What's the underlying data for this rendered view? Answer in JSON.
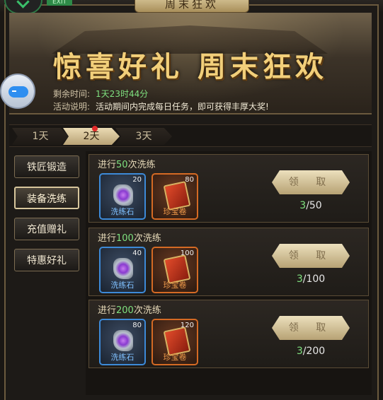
{
  "header": {
    "title": "周末狂欢",
    "exit_badge": "EXIT"
  },
  "banner": {
    "title": "惊喜好礼 周末狂欢",
    "remaining_label": "剩余时间:",
    "remaining_value": "1天23时44分",
    "desc_label": "活动说明:",
    "desc_value": "活动期间内完成每日任务，即可获得丰厚大奖!"
  },
  "day_tabs": [
    {
      "label": "1天"
    },
    {
      "label": "2天"
    },
    {
      "label": "3天"
    }
  ],
  "active_day_index": 1,
  "sidebar": {
    "items": [
      {
        "label": "铁匠锻造"
      },
      {
        "label": "装备洗练"
      },
      {
        "label": "充值赠礼"
      },
      {
        "label": "特惠好礼"
      }
    ],
    "active_index": 1
  },
  "tasks": [
    {
      "title_prefix": "进行",
      "title_count": "50",
      "title_suffix": "次洗练",
      "rewards": [
        {
          "name": "洗练石",
          "qty": "20",
          "icon": "refining-stone-icon"
        },
        {
          "name": "珍宝卷",
          "qty": "80",
          "icon": "treasure-scroll-icon"
        }
      ],
      "button_label": "领 取",
      "progress_current": "3",
      "progress_total": "/50"
    },
    {
      "title_prefix": "进行",
      "title_count": "100",
      "title_suffix": "次洗练",
      "rewards": [
        {
          "name": "洗练石",
          "qty": "40",
          "icon": "refining-stone-icon"
        },
        {
          "name": "珍宝卷",
          "qty": "100",
          "icon": "treasure-scroll-icon"
        }
      ],
      "button_label": "领 取",
      "progress_current": "3",
      "progress_total": "/100"
    },
    {
      "title_prefix": "进行",
      "title_count": "200",
      "title_suffix": "次洗练",
      "rewards": [
        {
          "name": "洗练石",
          "qty": "80",
          "icon": "refining-stone-icon"
        },
        {
          "name": "珍宝卷",
          "qty": "120",
          "icon": "treasure-scroll-icon"
        }
      ],
      "button_label": "领 取",
      "progress_current": "3",
      "progress_total": "/200"
    }
  ],
  "colors": {
    "accent_gold": "#f2cf7a",
    "progress_green": "#7fe07f",
    "blue_rarity": "#3d8ad8",
    "orange_rarity": "#d56a24"
  }
}
